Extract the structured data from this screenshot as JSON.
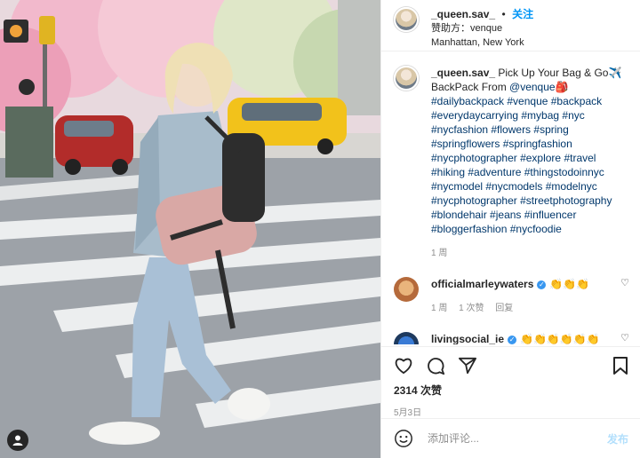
{
  "header": {
    "username": "_queen.sav_",
    "separator": "•",
    "follow_label": "关注",
    "sponsor_line": "赞助方：venque",
    "location": "Manhattan, New York"
  },
  "caption": {
    "username": "_queen.sav_",
    "text_prefix": " Pick Up Your Bag & Go✈️ BackPack From ",
    "mention": "@venque",
    "emoji": "🎒",
    "hashtags": "#dailybackpack #venque #backpack #everydaycarrying #mybag #nyc #nycfashion #flowers #spring #springflowers #springfashion #nycphotographer #explore #travel #hiking #adventure #thingstodoinnyc #nycmodel #nycmodels #modelnyc #nycphotographer #streetphotography #blondehair #jeans #influencer #bloggerfashion #nycfoodie",
    "time": "1 周"
  },
  "comments": [
    {
      "username": "officialmarleywaters",
      "text": "👏👏👏",
      "time": "1 周",
      "likes": "1 次赞",
      "reply": "回复"
    },
    {
      "username": "livingsocial_ie",
      "text": "👏👏👏👏👏👏"
    }
  ],
  "actions": {
    "like_count": "2314 次赞",
    "date": "5月3日"
  },
  "composer": {
    "placeholder": "添加评论...",
    "post_label": "发布"
  },
  "colors": {
    "accent": "#0095f6",
    "link": "#00376b",
    "muted": "#8e8e8e"
  }
}
